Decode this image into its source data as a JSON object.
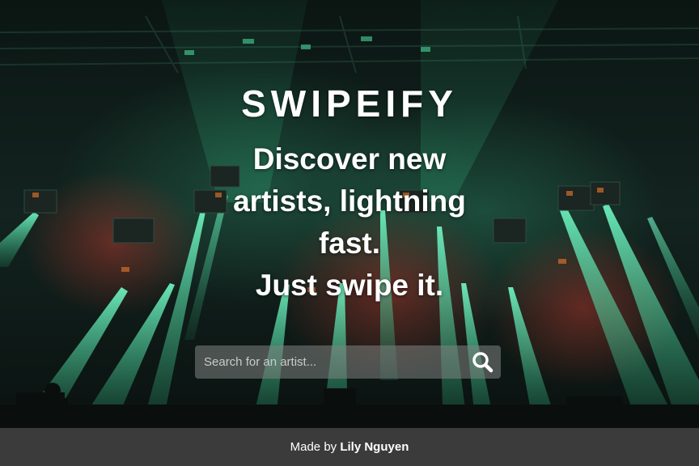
{
  "hero": {
    "brand": "SWIPEIFY",
    "tagline_lines": [
      "Discover new",
      "artists, lightning",
      "fast.",
      "Just swipe it."
    ]
  },
  "search": {
    "placeholder": "Search for an artist...",
    "value": "",
    "icon": "search-icon"
  },
  "footer": {
    "prefix": "Made by",
    "author": "Lily Nguyen"
  },
  "colors": {
    "footer_bg": "#3a3b3a",
    "light_beam": "#3ddc9a",
    "stage_red": "#8a2a22",
    "text": "#ffffff"
  }
}
